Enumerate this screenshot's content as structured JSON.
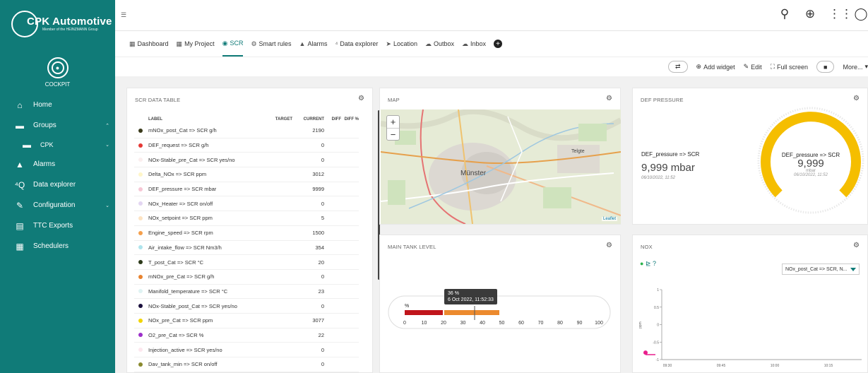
{
  "brand": {
    "name": "CPK Automotive",
    "tagline": "Member of the HEINZMANN Group"
  },
  "cockpit": {
    "label": "COCKPIT"
  },
  "nav": [
    {
      "label": "Home",
      "icon": "home-icon",
      "glyph": "⌂"
    },
    {
      "label": "Groups",
      "icon": "folder-icon",
      "glyph": "▬",
      "chev": "^"
    },
    {
      "label": "CPK",
      "icon": "folder-icon",
      "glyph": "▬",
      "chev": "v",
      "sub": true
    },
    {
      "label": "Alarms",
      "icon": "bell-icon",
      "glyph": "▲"
    },
    {
      "label": "Data explorer",
      "icon": "data-explorer-icon",
      "glyph": "⁴Q"
    },
    {
      "label": "Configuration",
      "icon": "configuration-icon",
      "glyph": "✎",
      "chev": "v"
    },
    {
      "label": "TTC Exports",
      "icon": "export-icon",
      "glyph": "▤"
    },
    {
      "label": "Schedulers",
      "icon": "calendar-icon",
      "glyph": "▦"
    }
  ],
  "tabs": [
    {
      "label": "Dashboard",
      "icon": "grid-icon",
      "glyph": "▦"
    },
    {
      "label": "My Project",
      "icon": "grid-icon",
      "glyph": "▦"
    },
    {
      "label": "SCR",
      "icon": "gauge-icon",
      "glyph": "◉",
      "active": true
    },
    {
      "label": "Smart rules",
      "icon": "smart-rules-icon",
      "glyph": "⚙"
    },
    {
      "label": "Alarms",
      "icon": "bell-icon",
      "glyph": "▲"
    },
    {
      "label": "Data explorer",
      "icon": "data-explorer-icon",
      "glyph": "⁴"
    },
    {
      "label": "Location",
      "icon": "location-icon",
      "glyph": "➤"
    },
    {
      "label": "Outbox",
      "icon": "outbox-icon",
      "glyph": "☁"
    },
    {
      "label": "Inbox",
      "icon": "inbox-icon",
      "glyph": "☁"
    }
  ],
  "actions": {
    "add_widget": "Add widget",
    "edit": "Edit",
    "full_screen": "Full screen",
    "more": "More..."
  },
  "scr_table": {
    "title": "SCR DATA TABLE",
    "headers": {
      "label": "LABEL",
      "target": "TARGET",
      "current": "CURRENT",
      "diff": "DIFF",
      "diff_pct": "DIFF %"
    },
    "rows": [
      {
        "color": "#3a3a1a",
        "label": "mNOx_post_Cat => SCR g/h",
        "current": "2190"
      },
      {
        "color": "#e53935",
        "label": "DEF_request => SCR g/h",
        "current": "0"
      },
      {
        "color": "#fbeeee",
        "label": "NOx-Stable_pre_Cat => SCR yes/no",
        "current": "0"
      },
      {
        "color": "#fff6c9",
        "label": "Delta_NOx => SCR ppm",
        "current": "3012"
      },
      {
        "color": "#f6c6d4",
        "label": "DEF_pressure => SCR mbar",
        "current": "9999"
      },
      {
        "color": "#e3d6f2",
        "label": "NOx_Heater => SCR on/off",
        "current": "0"
      },
      {
        "color": "#fde3c2",
        "label": "NOx_setpoint => SCR ppm",
        "current": "5"
      },
      {
        "color": "#f5a04c",
        "label": "Engine_speed => SCR rpm",
        "current": "1500"
      },
      {
        "color": "#aee4ec",
        "label": "Air_intake_flow => SCR Nm3/h",
        "current": "354"
      },
      {
        "color": "#2d3a1a",
        "label": "T_post_Cat => SCR °C",
        "current": "20"
      },
      {
        "color": "#e8832f",
        "label": "mNOx_pre_Cat => SCR g/h",
        "current": "0"
      },
      {
        "color": "#dff3f3",
        "label": "Manifold_temperature => SCR °C",
        "current": "23"
      },
      {
        "color": "#1a0f3d",
        "label": "NOx-Stable_post_Cat => SCR yes/no",
        "current": "0"
      },
      {
        "color": "#f1d400",
        "label": "NOx_pre_Cat => SCR ppm",
        "current": "3077"
      },
      {
        "color": "#9c2fc9",
        "label": "O2_pre_Cat => SCR %",
        "current": "22"
      },
      {
        "color": "#fde7ee",
        "label": "Injection_active => SCR yes/no",
        "current": "0"
      },
      {
        "color": "#8a8a2e",
        "label": "Dav_tank_min => SCR on/off",
        "current": "0"
      }
    ]
  },
  "map": {
    "title": "MAP",
    "city": "Münster",
    "town": "Telgte",
    "attribution": "Leaflet",
    "zoom_in": "+",
    "zoom_out": "−"
  },
  "tank": {
    "title": "MAIN TANK LEVEL",
    "unit": "%",
    "tooltip_value": "36 %",
    "tooltip_date": "6 Oct 2022, 11:52:33",
    "level": 36,
    "ticks": [
      "0",
      "10",
      "20",
      "30",
      "40",
      "50",
      "60",
      "70",
      "80",
      "90",
      "100"
    ]
  },
  "def_pressure": {
    "title": "DEF PRESSURE",
    "label": "DEF_pressure => SCR",
    "value": "9,999 mbar",
    "date": "06/10/2022, 11:52",
    "gauge_label": "DEF_pressure => SCR",
    "gauge_value": "9,999",
    "gauge_unit": "mbar",
    "gauge_date": "06/10/2022, 11:52",
    "colors": {
      "fill": "#f5be00"
    }
  },
  "nox": {
    "title": "NOX",
    "select": "NOx_post_Cat => SCR, N...",
    "ylabel": "ppm",
    "chart_data": {
      "type": "line",
      "title": "NOX",
      "y_ticks": [
        "1",
        "0.5",
        "0",
        "-0.5",
        "-1"
      ],
      "x_ticks": [
        "09:30",
        "09:45",
        "10:00",
        "10:15"
      ],
      "ylim": [
        -1,
        1
      ],
      "series": [
        {
          "name": "NOx_post_Cat => SCR, N...",
          "values": [
            -0.8
          ]
        }
      ]
    }
  }
}
